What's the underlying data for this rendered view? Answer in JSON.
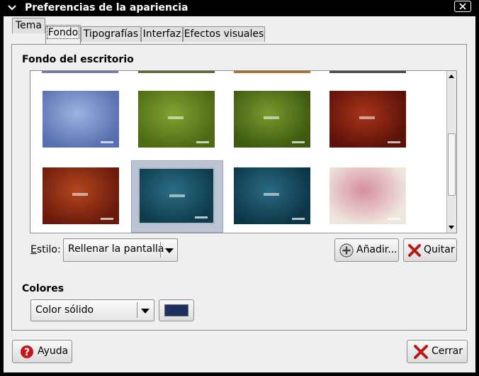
{
  "window": {
    "title": "Preferencias de la apariencia"
  },
  "tabs": [
    {
      "label": "Tema",
      "active": false
    },
    {
      "label": "Fondo",
      "active": true
    },
    {
      "label": "Tipografías",
      "active": false
    },
    {
      "label": "Interfaz",
      "active": false
    },
    {
      "label": "Efectos visuales",
      "active": false
    }
  ],
  "background": {
    "section_title": "Fondo del escritorio",
    "style_label": "Estilo:",
    "style_value": "Rellenar la pantalla",
    "add_button": "Añadir...",
    "remove_button": "Quitar"
  },
  "wallpapers": [
    {
      "name": "blue-fractal",
      "color1": "#5870b0",
      "color2": "#9db3df"
    },
    {
      "name": "green-dark",
      "color1": "#4e6a14",
      "color2": "#82a232"
    },
    {
      "name": "green-dark-2",
      "color1": "#3e5a10",
      "color2": "#7a9a2e"
    },
    {
      "name": "red-dark",
      "color1": "#5c1208",
      "color2": "#a8341a"
    },
    {
      "name": "red-orange",
      "color1": "#6a1a0c",
      "color2": "#b4461e"
    },
    {
      "name": "teal-dark-selected",
      "color1": "#0f3c4c",
      "color2": "#2a6e86"
    },
    {
      "name": "teal-dark",
      "color1": "#0c3646",
      "color2": "#2a6a84"
    },
    {
      "name": "pink-white",
      "color1": "#efe7de",
      "color2": "#d58ea0"
    }
  ],
  "colors": {
    "section_title": "Colores",
    "mode_value": "Color sólido",
    "swatch_color": "#1e3060"
  },
  "footer": {
    "help_button": "Ayuda",
    "close_button": "Cerrar"
  }
}
